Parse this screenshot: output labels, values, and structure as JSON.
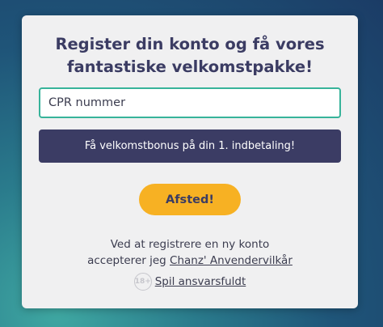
{
  "form": {
    "title_line1": "Register din konto og få vores",
    "title_line2": "fantastiske velkomstpakke!",
    "cpr_placeholder": "CPR nummer",
    "cpr_value": "",
    "bonus_label": "Få velkomstbonus på din 1. indbetaling!",
    "submit_label": "Afsted!",
    "terms_line1": "Ved at registrere en ny konto",
    "terms_prefix": "accepterer jeg ",
    "terms_link": "Chanz' Anvendervilkår",
    "age_badge": "18+",
    "responsible_link": "Spil ansvarsfuldt"
  },
  "colors": {
    "accent_teal": "#37b39a",
    "navy": "#3b3c64",
    "button_yellow": "#f7b123"
  },
  "icons": {
    "age": "age-18-plus-icon"
  }
}
